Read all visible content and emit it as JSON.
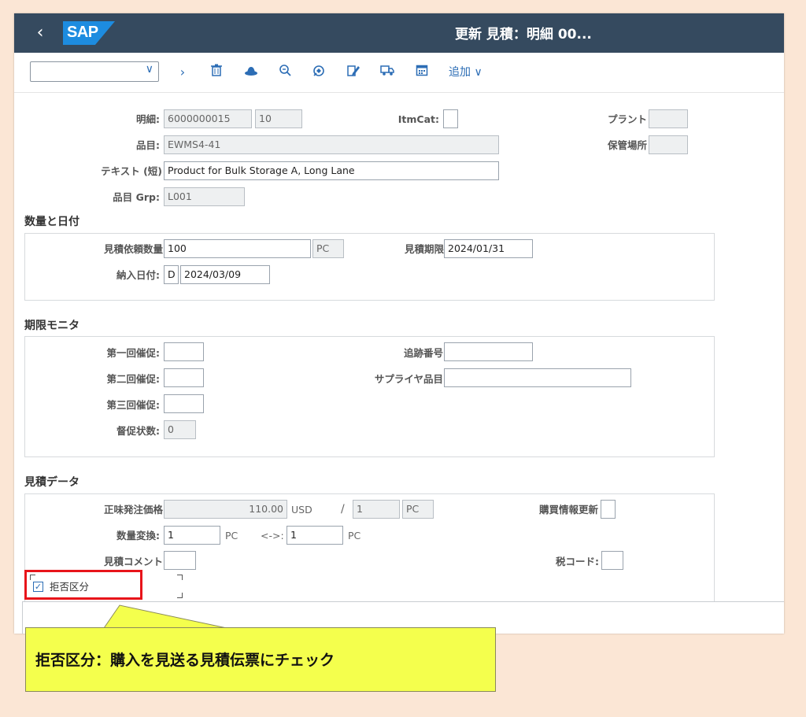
{
  "shell": {
    "back_glyph": "‹",
    "logo_text": "SAP",
    "title": "更新 見積：明細 00..."
  },
  "toolbar": {
    "select_value": "",
    "select_chevron": "∨",
    "icons": [
      "chevron-right-icon",
      "delete-icon",
      "hat-icon",
      "zoom-icon",
      "tag-icon",
      "edit-icon",
      "truck-icon",
      "calendar-icon"
    ],
    "icon_glyphs": [
      "›",
      "🗑",
      "⛑",
      "⌕",
      "✣",
      "✎",
      "⛟",
      "▦"
    ],
    "add_label": "追加",
    "add_chevron": "∨"
  },
  "item": {
    "item_label": "明細:",
    "doc_no": "6000000015",
    "item_no": "10",
    "itmcat_label": "ItmCat:",
    "itmcat_value": "",
    "plant_label": "プラント",
    "plant_value": "",
    "material_label": "品目:",
    "material_value": "EWMS4-41",
    "storage_label": "保管場所",
    "storage_value": "",
    "short_text_label": "テキスト (短)",
    "short_text_value": "Product for Bulk Storage A, Long Lane",
    "mat_group_label": "品目 Grp:",
    "mat_group_value": "L001"
  },
  "qty_section": {
    "title": "数量と日付",
    "rfq_qty_label": "見積依頼数量",
    "rfq_qty_value": "100",
    "rfq_qty_unit": "PC",
    "deadline_label": "見積期限",
    "deadline_value": "2024/01/31",
    "delivery_label": "納入日付:",
    "delivery_type": "D",
    "delivery_value": "2024/03/09"
  },
  "deadline_section": {
    "title": "期限モニタ",
    "reminder1_label": "第一回催促:",
    "reminder1_value": "",
    "reminder2_label": "第二回催促:",
    "reminder2_value": "",
    "reminder3_label": "第三回催促:",
    "reminder3_value": "",
    "urge_label": "督促状数:",
    "urge_value": "0",
    "tracking_label": "追跡番号",
    "tracking_value": "",
    "vendor_mat_label": "サプライヤ品目",
    "vendor_mat_value": ""
  },
  "quote_section": {
    "title": "見積データ",
    "net_price_label": "正味発注価格",
    "net_price_value": "110.00",
    "currency": "USD",
    "per_sep": "/",
    "price_unit_value": "1",
    "price_unit_uom": "PC",
    "info_update_label": "購買情報更新",
    "conv_label": "数量変換:",
    "conv_value1": "1",
    "conv_unit1": "PC",
    "conv_arrow": "<->:",
    "conv_value2": "1",
    "conv_unit2": "PC",
    "comment_label": "見積コメント",
    "comment_value": "",
    "tax_label": "税コード:",
    "tax_value": "",
    "reject_label": "拒否区分",
    "reject_checked": "✓"
  },
  "callout": {
    "text": "拒否区分：購入を見送る見積伝票にチェック"
  },
  "colors": {
    "shell_bg": "#354a5f",
    "sap_blue": "#1d8ce0",
    "highlight_red": "#e8141a",
    "callout_yellow": "#f4ff4d"
  }
}
